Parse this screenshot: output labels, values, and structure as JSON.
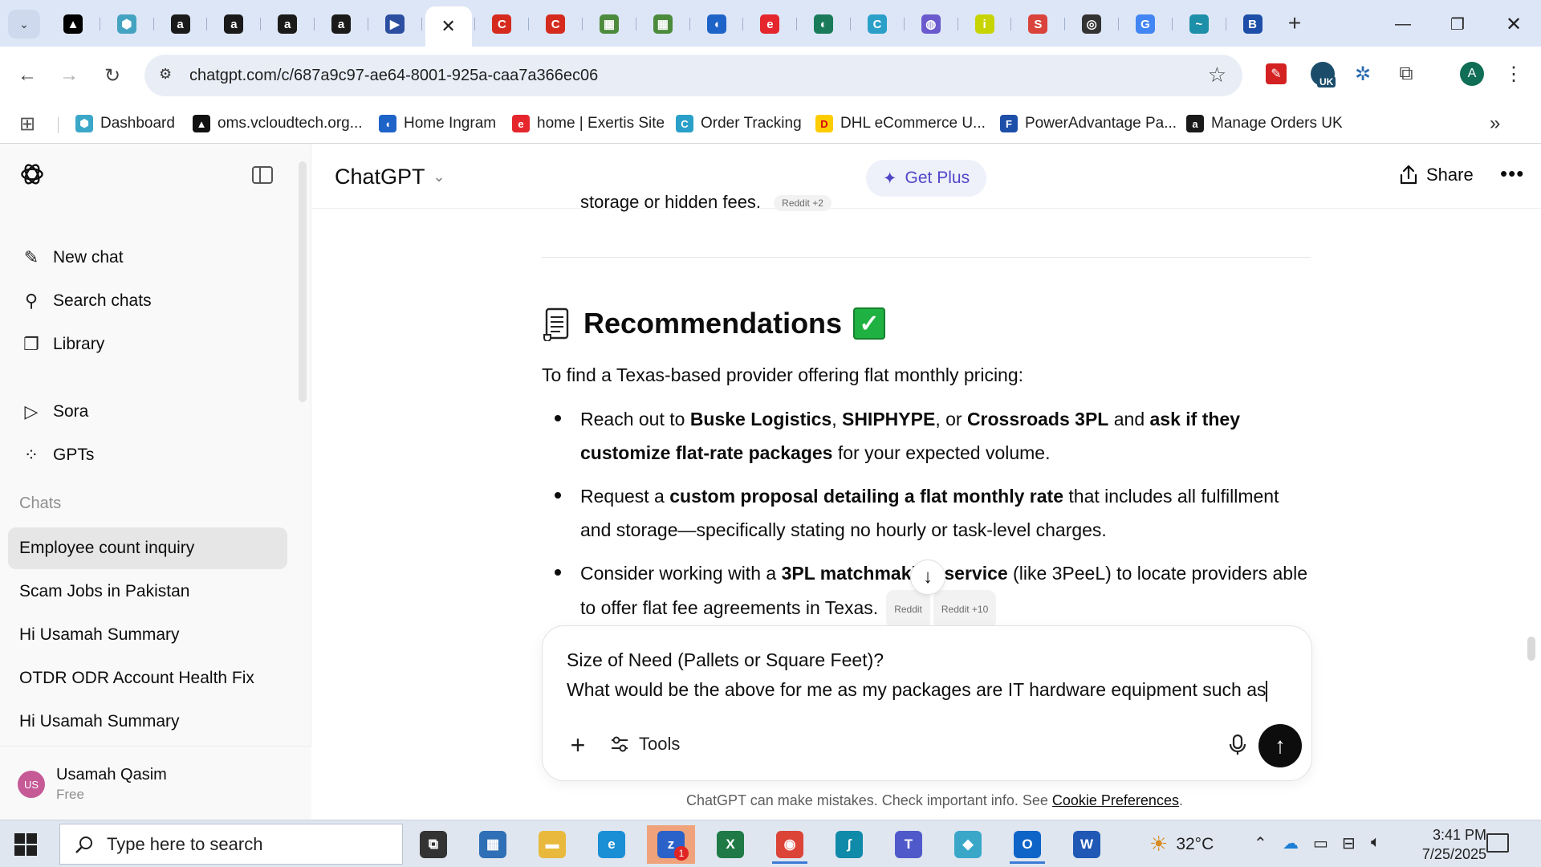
{
  "browser": {
    "tabs": [
      {
        "icon": "chrome-icon",
        "color": "#000000",
        "glyph": "▲"
      },
      {
        "icon": "hexagon-app-icon",
        "color": "#45a3c2",
        "glyph": "⬢"
      },
      {
        "icon": "amazon-icon",
        "color": "#1a1a1a",
        "glyph": "a"
      },
      {
        "icon": "amazon-icon",
        "color": "#1a1a1a",
        "glyph": "a"
      },
      {
        "icon": "amazon-icon",
        "color": "#1a1a1a",
        "glyph": "a"
      },
      {
        "icon": "amazon-icon",
        "color": "#1a1a1a",
        "glyph": "a"
      },
      {
        "icon": "arrow-app-icon",
        "color": "#2b4ea0",
        "glyph": "▶"
      },
      {
        "icon": "chatgpt-icon",
        "color": "#000000",
        "glyph": "✕"
      },
      {
        "icon": "c-app-icon",
        "color": "#d52b1e",
        "glyph": "C"
      },
      {
        "icon": "c-app-icon",
        "color": "#d52b1e",
        "glyph": "C"
      },
      {
        "icon": "sheet-icon",
        "color": "#4c8a3c",
        "glyph": "▦"
      },
      {
        "icon": "sheet-icon",
        "color": "#4c8a3c",
        "glyph": "▦"
      },
      {
        "icon": "ingram-icon",
        "color": "#1e64c8",
        "glyph": "◖"
      },
      {
        "icon": "exertis-icon",
        "color": "#e5262d",
        "glyph": "e"
      },
      {
        "icon": "dpd-icon",
        "color": "#1a7b5b",
        "glyph": "◐"
      },
      {
        "icon": "tracking-icon",
        "color": "#2aa0c9",
        "glyph": "C"
      },
      {
        "icon": "chart-app-icon",
        "color": "#6a5acd",
        "glyph": "◍"
      },
      {
        "icon": "infos-icon",
        "color": "#c8d400",
        "glyph": "i"
      },
      {
        "icon": "shiva-icon",
        "color": "#d9433b",
        "glyph": "S"
      },
      {
        "icon": "chrome-icon",
        "color": "#333333",
        "glyph": "◎"
      },
      {
        "icon": "google-icon",
        "color": "#4285f4",
        "glyph": "G"
      },
      {
        "icon": "wave-icon",
        "color": "#1e8fa8",
        "glyph": "~"
      },
      {
        "icon": "b-app-icon",
        "color": "#1e4fa8",
        "glyph": "B"
      }
    ],
    "url": "chatgpt.com/c/687a9c97-ae64-8001-925a-caa7a366ec06",
    "profile_initial": "A",
    "ext_badge": "UK",
    "bookmarks": [
      {
        "label": "Dashboard",
        "icon": "dashboard-icon",
        "color": "#3ba7c9",
        "glyph": "⬢"
      },
      {
        "label": "oms.vcloudtech.org...",
        "icon": "oms-icon",
        "color": "#111111",
        "glyph": "▲"
      },
      {
        "label": "Home Ingram",
        "icon": "ingram-icon",
        "color": "#1e64c8",
        "glyph": "◖"
      },
      {
        "label": "home | Exertis Site",
        "icon": "exertis-icon",
        "color": "#e5262d",
        "glyph": "e"
      },
      {
        "label": "Order Tracking",
        "icon": "tracking-icon",
        "color": "#2aa0c9",
        "glyph": "C"
      },
      {
        "label": "DHL eCommerce U...",
        "icon": "dhl-icon",
        "color": "#ffcc00",
        "glyph": "D"
      },
      {
        "label": "PowerAdvantage Pa...",
        "icon": "poweradvantage-icon",
        "color": "#1e4fa8",
        "glyph": "F"
      },
      {
        "label": "Manage Orders UK",
        "icon": "amazon-icon",
        "color": "#1a1a1a",
        "glyph": "a"
      }
    ]
  },
  "sidebar": {
    "nav": [
      {
        "label": "New chat",
        "icon": "new-chat-icon",
        "glyph": "✎"
      },
      {
        "label": "Search chats",
        "icon": "search-icon",
        "glyph": "⚲"
      },
      {
        "label": "Library",
        "icon": "library-icon",
        "glyph": "❐"
      },
      {
        "label": "Sora",
        "icon": "sora-icon",
        "glyph": "▷"
      },
      {
        "label": "GPTs",
        "icon": "gpts-icon",
        "glyph": "⁘"
      }
    ],
    "section_label": "Chats",
    "chats": [
      {
        "label": "Employee count inquiry",
        "selected": true
      },
      {
        "label": "Scam Jobs in Pakistan",
        "selected": false
      },
      {
        "label": "Hi Usamah Summary",
        "selected": false
      },
      {
        "label": "OTDR ODR Account Health Fix",
        "selected": false
      },
      {
        "label": "Hi Usamah Summary",
        "selected": false
      }
    ],
    "user": {
      "initials": "US",
      "name": "Usamah Qasim",
      "plan": "Free"
    }
  },
  "header": {
    "model": "ChatGPT",
    "get_plus": "Get Plus",
    "share": "Share"
  },
  "conversation": {
    "prev_tail": "storage or hidden fees.",
    "prev_source": "Reddit +2",
    "heading": "Recommendations",
    "intro": "To find a Texas-based provider offering flat monthly pricing:",
    "bullet1": {
      "a": "Reach out to ",
      "b1": "Buske Logistics",
      "c": ", ",
      "b2": "SHIPHYPE",
      "d": ", or ",
      "b3": "Crossroads 3PL",
      "e": " and ",
      "b4": "ask if they customize flat-rate packages",
      "f": " for your expected volume."
    },
    "bullet2": {
      "a": "Request a ",
      "b1": "custom proposal detailing a flat monthly rate",
      "c": " that includes all fulfillment and storage—specifically stating no hourly or task-level charges."
    },
    "bullet3": {
      "a": "Consider working with a ",
      "b1": "3PL matchmaking service",
      "c": " (like 3PeeL) to locate providers able to offer flat fee agreements in Texas.",
      "src1": "Reddit",
      "src2": "Reddit +10"
    }
  },
  "composer": {
    "text": "Size of Need (Pallets or Square Feet)?\nWhat would be the above for me as my packages are IT hardware equipment such as",
    "tools_label": "Tools",
    "disclaimer": "ChatGPT can make mistakes. Check important info. See ",
    "disclaimer_link": "Cookie Preferences",
    "disclaimer_end": "."
  },
  "taskbar": {
    "search_placeholder": "Type here to search",
    "apps": [
      {
        "icon": "task-view-icon",
        "color": "#333333",
        "glyph": "⧉",
        "active": false
      },
      {
        "icon": "calculator-icon",
        "color": "#2f6fb5",
        "glyph": "▦",
        "active": false
      },
      {
        "icon": "file-explorer-icon",
        "color": "#e8b93c",
        "glyph": "▬",
        "active": false
      },
      {
        "icon": "edge-icon",
        "color": "#1a8fd6",
        "glyph": "e",
        "active": false
      },
      {
        "icon": "zoho-icon",
        "color": "#2a62c9",
        "glyph": "z",
        "active": true,
        "badge": "1"
      },
      {
        "icon": "excel-icon",
        "color": "#1f7a45",
        "glyph": "X",
        "active": false
      },
      {
        "icon": "chrome-icon",
        "color": "#db4437",
        "glyph": "◉",
        "active": false
      },
      {
        "icon": "sketch-icon",
        "color": "#0f8aa8",
        "glyph": "ʃ",
        "active": false
      },
      {
        "icon": "teams-icon",
        "color": "#5059c9",
        "glyph": "T",
        "active": false
      },
      {
        "icon": "app-cube-icon",
        "color": "#3aa7c9",
        "glyph": "◆",
        "active": false
      },
      {
        "icon": "outlook-icon",
        "color": "#0f64c8",
        "glyph": "O",
        "active": false
      },
      {
        "icon": "word-icon",
        "color": "#1f58b5",
        "glyph": "W",
        "active": false
      }
    ],
    "temperature": "32°C",
    "time": "3:41 PM",
    "date": "7/25/2025"
  }
}
